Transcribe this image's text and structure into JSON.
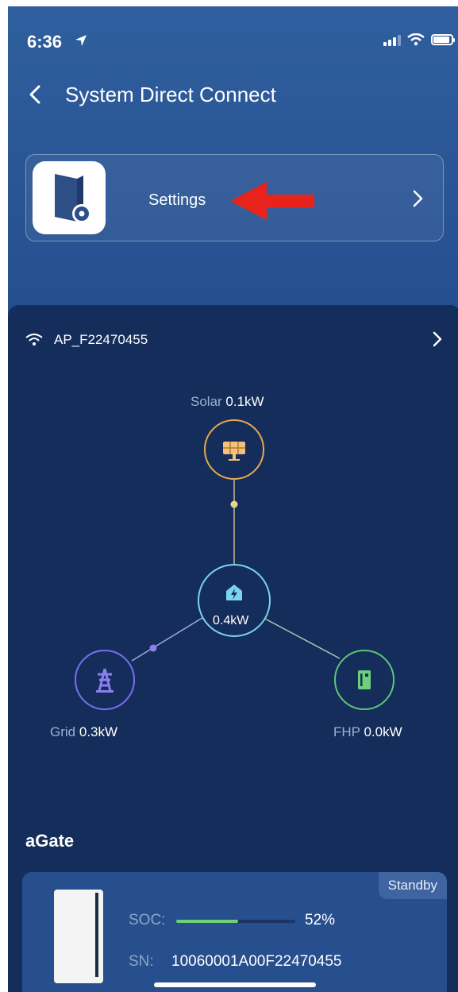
{
  "status_bar": {
    "time": "6:36"
  },
  "nav": {
    "title": "System Direct Connect"
  },
  "settings_card": {
    "label": "Settings"
  },
  "connection": {
    "ssid": "AP_F22470455"
  },
  "flow": {
    "solar": {
      "name": "Solar",
      "value": "0.1kW",
      "color": "#e7a94e"
    },
    "home": {
      "value": "0.4kW",
      "color": "#7ad4f0"
    },
    "grid": {
      "name": "Grid",
      "value": "0.3kW",
      "color": "#7b6ef0"
    },
    "fhp": {
      "name": "FHP",
      "value": "0.0kW",
      "color": "#5fc67a"
    }
  },
  "agate": {
    "title": "aGate",
    "status": "Standby",
    "soc_label": "SOC:",
    "soc_value": "52%",
    "soc_fraction": 0.52,
    "sn_label": "SN:",
    "sn_value": "10060001A00F22470455"
  }
}
